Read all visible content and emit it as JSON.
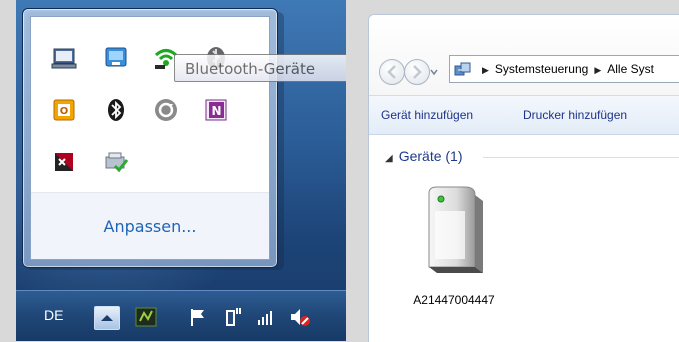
{
  "tray_flyout": {
    "icons": [
      "laptop-icon",
      "network-icon",
      "wifi-icon",
      "bluetooth-file-icon",
      "office-icon",
      "bluetooth-icon",
      "sync-icon",
      "onenote-icon",
      "kaspersky-icon",
      "printer-check-icon"
    ],
    "tooltip": "Bluetooth-Geräte",
    "customize_link": "Anpassen..."
  },
  "taskbar": {
    "language": "DE",
    "icons": [
      "show-hidden-icons",
      "utility-icon",
      "flag-icon",
      "power-icon",
      "signal-icon",
      "volume-muted-icon"
    ]
  },
  "explorer": {
    "breadcrumb": [
      "Systemsteuerung",
      "Alle Syst"
    ],
    "commands": {
      "add_device": "Gerät hinzufügen",
      "add_printer": "Drucker hinzufügen"
    },
    "group": {
      "title": "Geräte (1)"
    },
    "devices": [
      {
        "name": "A21447004447",
        "icon": "computer-tower-icon"
      }
    ]
  },
  "colors": {
    "link_blue": "#1f64b5",
    "taskbar": "#1f4676",
    "command_text": "#1e3287"
  }
}
